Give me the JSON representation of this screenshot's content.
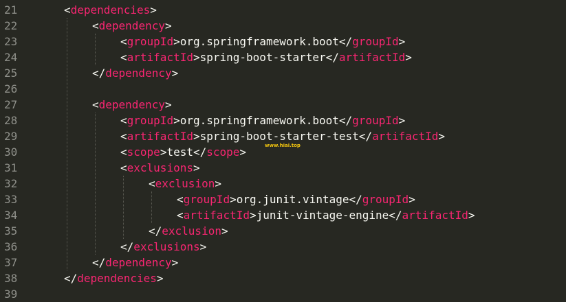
{
  "editor": {
    "background": "#272822",
    "tag_color": "#f92672",
    "text_color": "#f8f8f2",
    "line_number_color": "#8f908a",
    "lines": [
      {
        "n": "21",
        "indent": 1,
        "parts": [
          [
            "b",
            "<"
          ],
          [
            "t",
            "dependencies"
          ],
          [
            "b",
            ">"
          ]
        ]
      },
      {
        "n": "22",
        "indent": 2,
        "parts": [
          [
            "b",
            "<"
          ],
          [
            "t",
            "dependency"
          ],
          [
            "b",
            ">"
          ]
        ]
      },
      {
        "n": "23",
        "indent": 3,
        "parts": [
          [
            "b",
            "<"
          ],
          [
            "t",
            "groupId"
          ],
          [
            "b",
            ">"
          ],
          [
            "x",
            "org.springframework.boot"
          ],
          [
            "b",
            "</"
          ],
          [
            "t",
            "groupId"
          ],
          [
            "b",
            ">"
          ]
        ]
      },
      {
        "n": "24",
        "indent": 3,
        "parts": [
          [
            "b",
            "<"
          ],
          [
            "t",
            "artifactId"
          ],
          [
            "b",
            ">"
          ],
          [
            "x",
            "spring-boot-starter"
          ],
          [
            "b",
            "</"
          ],
          [
            "t",
            "artifactId"
          ],
          [
            "b",
            ">"
          ]
        ]
      },
      {
        "n": "25",
        "indent": 2,
        "parts": [
          [
            "b",
            "</"
          ],
          [
            "t",
            "dependency"
          ],
          [
            "b",
            ">"
          ]
        ]
      },
      {
        "n": "26",
        "indent": 0,
        "parts": []
      },
      {
        "n": "27",
        "indent": 2,
        "parts": [
          [
            "b",
            "<"
          ],
          [
            "t",
            "dependency"
          ],
          [
            "b",
            ">"
          ]
        ]
      },
      {
        "n": "28",
        "indent": 3,
        "parts": [
          [
            "b",
            "<"
          ],
          [
            "t",
            "groupId"
          ],
          [
            "b",
            ">"
          ],
          [
            "x",
            "org.springframework.boot"
          ],
          [
            "b",
            "</"
          ],
          [
            "t",
            "groupId"
          ],
          [
            "b",
            ">"
          ]
        ]
      },
      {
        "n": "29",
        "indent": 3,
        "parts": [
          [
            "b",
            "<"
          ],
          [
            "t",
            "artifactId"
          ],
          [
            "b",
            ">"
          ],
          [
            "x",
            "spring-boot-starter-test"
          ],
          [
            "b",
            "</"
          ],
          [
            "t",
            "artifactId"
          ],
          [
            "b",
            ">"
          ]
        ]
      },
      {
        "n": "30",
        "indent": 3,
        "parts": [
          [
            "b",
            "<"
          ],
          [
            "t",
            "scope"
          ],
          [
            "b",
            ">"
          ],
          [
            "x",
            "test"
          ],
          [
            "b",
            "</"
          ],
          [
            "t",
            "scope"
          ],
          [
            "b",
            ">"
          ]
        ]
      },
      {
        "n": "31",
        "indent": 3,
        "parts": [
          [
            "b",
            "<"
          ],
          [
            "t",
            "exclusions"
          ],
          [
            "b",
            ">"
          ]
        ]
      },
      {
        "n": "32",
        "indent": 4,
        "parts": [
          [
            "b",
            "<"
          ],
          [
            "t",
            "exclusion"
          ],
          [
            "b",
            ">"
          ]
        ]
      },
      {
        "n": "33",
        "indent": 5,
        "parts": [
          [
            "b",
            "<"
          ],
          [
            "t",
            "groupId"
          ],
          [
            "b",
            ">"
          ],
          [
            "x",
            "org.junit.vintage"
          ],
          [
            "b",
            "</"
          ],
          [
            "t",
            "groupId"
          ],
          [
            "b",
            ">"
          ]
        ]
      },
      {
        "n": "34",
        "indent": 5,
        "parts": [
          [
            "b",
            "<"
          ],
          [
            "t",
            "artifactId"
          ],
          [
            "b",
            ">"
          ],
          [
            "x",
            "junit-vintage-engine"
          ],
          [
            "b",
            "</"
          ],
          [
            "t",
            "artifactId"
          ],
          [
            "b",
            ">"
          ]
        ]
      },
      {
        "n": "35",
        "indent": 4,
        "parts": [
          [
            "b",
            "</"
          ],
          [
            "t",
            "exclusion"
          ],
          [
            "b",
            ">"
          ]
        ]
      },
      {
        "n": "36",
        "indent": 3,
        "parts": [
          [
            "b",
            "</"
          ],
          [
            "t",
            "exclusions"
          ],
          [
            "b",
            ">"
          ]
        ]
      },
      {
        "n": "37",
        "indent": 2,
        "parts": [
          [
            "b",
            "</"
          ],
          [
            "t",
            "dependency"
          ],
          [
            "b",
            ">"
          ]
        ]
      },
      {
        "n": "38",
        "indent": 1,
        "parts": [
          [
            "b",
            "</"
          ],
          [
            "t",
            "dependencies"
          ],
          [
            "b",
            ">"
          ]
        ]
      },
      {
        "n": "39",
        "indent": 0,
        "parts": []
      }
    ]
  },
  "watermark": {
    "text": "www.hiai.top",
    "color": "#f1c40f"
  }
}
